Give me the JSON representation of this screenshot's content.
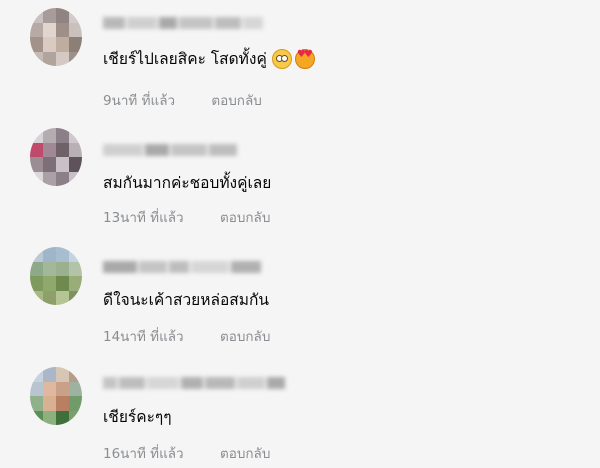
{
  "comments": [
    {
      "author_blurred": true,
      "text": "เชียร์ไปเลยสิคะ โสดทั้งคู่",
      "emojis": [
        "flushed-face-emoji",
        "smiling-face-with-hearts-emoji"
      ],
      "time": "9นาที ที่แล้ว",
      "reply_label": "ตอบกลับ",
      "avatar_colors": [
        "#c9c0bf",
        "#a79c99",
        "#8f8482",
        "#d2cbca",
        "#b7aaa5",
        "#e1d5cf",
        "#9e8f88",
        "#cbc1bc",
        "#a3928a",
        "#d9cbc2",
        "#bfae9f",
        "#8c7f78",
        "#c5bab4",
        "#b1a49d",
        "#d4c9c3",
        "#9d918b"
      ]
    },
    {
      "author_blurred": true,
      "text": "สมกันมากค่ะชอบทั้งคู่เลย",
      "emojis": [],
      "time": "13นาที ที่แล้ว",
      "reply_label": "ตอบกลับ",
      "avatar_colors": [
        "#d7d3d6",
        "#b5acb2",
        "#8d7f88",
        "#cfc8cc",
        "#c04a6b",
        "#a08995",
        "#6f6168",
        "#b8b0b5",
        "#9a8d94",
        "#7d6f78",
        "#c9c1c6",
        "#5e535a",
        "#dcd7da",
        "#aaa1a7",
        "#8b8087",
        "#c7c0c4"
      ]
    },
    {
      "author_blurred": true,
      "text": "ดีใจนะเค้าสวยหล่อสมกัน",
      "emojis": [],
      "time": "14นาที ที่แล้ว",
      "reply_label": "ตอบกลับ",
      "avatar_colors": [
        "#b9c9d8",
        "#9fb5c8",
        "#a8bdd0",
        "#c5d3e0",
        "#8ea98a",
        "#a3b79a",
        "#9bb08f",
        "#b3c3a7",
        "#7f9a5e",
        "#8fa86c",
        "#6f8a4e",
        "#98ad78",
        "#a6b884",
        "#8da06b",
        "#b5c493",
        "#7e9260"
      ]
    },
    {
      "author_blurred": true,
      "text": "เชียร์คะๆๆ",
      "emojis": [],
      "time": "16นาที ที่แล้ว",
      "reply_label": "ตอบกลับ",
      "avatar_colors": [
        "#c7d2df",
        "#a9b7c6",
        "#d8c6b5",
        "#b59d8b",
        "#b8c4cf",
        "#e0b8a0",
        "#c9a088",
        "#9db2a0",
        "#8fb18a",
        "#d8b092",
        "#b87f62",
        "#6f9c68",
        "#5e8e58",
        "#8db07c",
        "#3f6f3a",
        "#7aa06c"
      ]
    }
  ]
}
